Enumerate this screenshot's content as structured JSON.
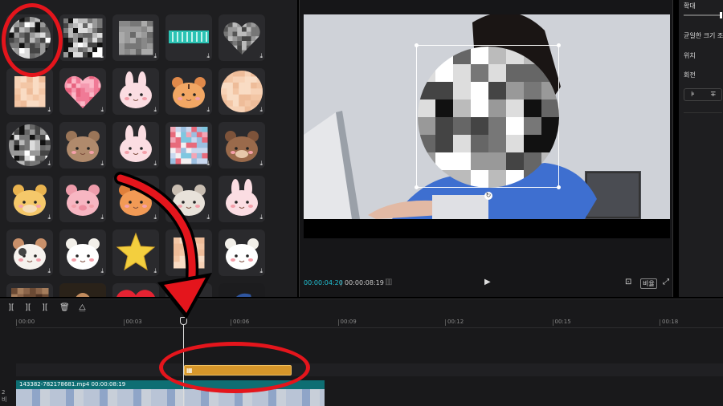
{
  "library": {
    "stickers": [
      {
        "name": "mosaic-circle-sticker",
        "kind": "mosaic-circle",
        "download": false
      },
      {
        "name": "mosaic-square-sticker",
        "kind": "mosaic-square",
        "download": true
      },
      {
        "name": "mosaic-gray-sticker",
        "kind": "mosaic-gray",
        "download": true
      },
      {
        "name": "teal-tape-sticker",
        "kind": "tape",
        "download": true
      },
      {
        "name": "mosaic-heart-sticker",
        "kind": "mosaic-heart",
        "download": true
      },
      {
        "name": "skin-mosaic-square-sticker",
        "kind": "skin-square",
        "download": true
      },
      {
        "name": "pink-heart-sticker",
        "kind": "pink-heart",
        "download": true
      },
      {
        "name": "bunny-sticker",
        "kind": "bunny",
        "download": true
      },
      {
        "name": "tiger-sticker",
        "kind": "tiger",
        "download": true
      },
      {
        "name": "skin-mosaic-circle-sticker",
        "kind": "skin-circle",
        "download": true
      },
      {
        "name": "mosaic-circle-2-sticker",
        "kind": "mosaic-circle",
        "download": true
      },
      {
        "name": "brown-bear-sticker",
        "kind": "bear-fuzzy",
        "download": true
      },
      {
        "name": "bunny-2-sticker",
        "kind": "bunny",
        "download": true
      },
      {
        "name": "colorful-mosaic-sticker",
        "kind": "color-mosaic",
        "download": true
      },
      {
        "name": "bear-sticker",
        "kind": "bear",
        "download": true
      },
      {
        "name": "cow-sticker",
        "kind": "cow",
        "download": true
      },
      {
        "name": "pink-pig-sticker",
        "kind": "pig",
        "download": true
      },
      {
        "name": "orange-cat-sticker",
        "kind": "orange-cat",
        "download": true
      },
      {
        "name": "gray-cat-sticker",
        "kind": "gray-cat",
        "download": true
      },
      {
        "name": "bunny-3-sticker",
        "kind": "bunny",
        "download": true
      },
      {
        "name": "calico-cat-sticker",
        "kind": "calico",
        "download": true
      },
      {
        "name": "sheep-sticker",
        "kind": "sheep",
        "download": true
      },
      {
        "name": "star-sticker",
        "kind": "star",
        "download": true
      },
      {
        "name": "skin-square-2-sticker",
        "kind": "skin-square",
        "download": false
      },
      {
        "name": "sheep-2-sticker",
        "kind": "sheep",
        "download": true
      },
      {
        "name": "brown-mosaic-sticker",
        "kind": "brown-mosaic",
        "download": false
      },
      {
        "name": "portrait-painting-sticker",
        "kind": "portrait",
        "download": false
      },
      {
        "name": "red-heart-sticker",
        "kind": "red-heart",
        "download": false
      },
      {
        "name": "blank-sticker",
        "kind": "blank",
        "download": false
      },
      {
        "name": "pearl-earring-sticker",
        "kind": "pearl",
        "download": false
      }
    ]
  },
  "player": {
    "current_time": "00:00:04:20",
    "separator": "|",
    "total_time": "00:00:08:19",
    "ratio_label": "비율"
  },
  "properties": {
    "scale_label": "확대",
    "uniform_scale_label": "균일한 크기 조",
    "position_label": "위치",
    "rotation_label": "회전"
  },
  "timeline": {
    "ticks": [
      "00:00",
      "00:03",
      "00:06",
      "00:09",
      "00:12",
      "00:15",
      "00:18"
    ],
    "video_clip_name": "143382-782178681.mp4",
    "video_clip_duration": "00:00:08:19",
    "track_label_line1": "2",
    "track_label_line2": "비"
  },
  "colors": {
    "annotation_red": "#e4151c",
    "timecode_cyan": "#22c3d6",
    "sticker_clip": "#d6962a",
    "video_clip": "#0e6e73"
  }
}
